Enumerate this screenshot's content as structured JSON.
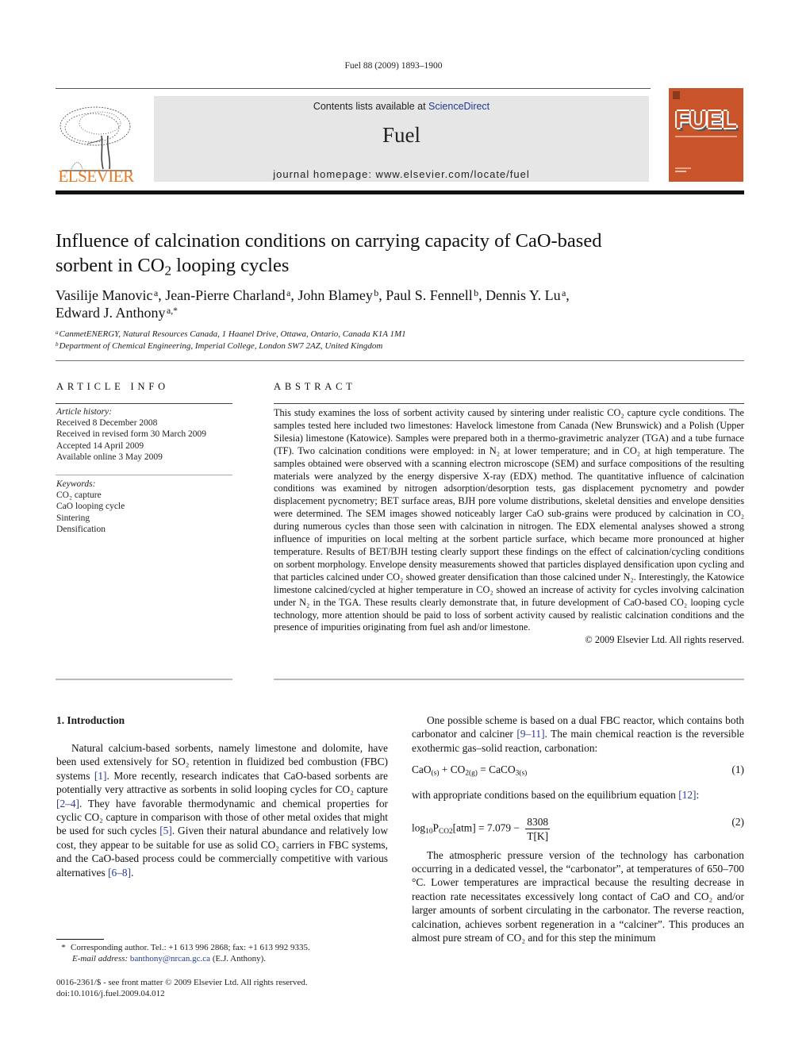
{
  "citation": "Fuel 88 (2009) 1893–1900",
  "masthead": {
    "contents_prefix": "Contents lists available at ",
    "contents_link": "ScienceDirect",
    "journal_title": "Fuel",
    "homepage": "journal homepage: www.elsevier.com/locate/fuel"
  },
  "publisher_logo_text": "ELSEVIER",
  "cover": {
    "title": "FUEL",
    "bg_color": "#c9542a"
  },
  "colors": {
    "link": "#2b3990",
    "elsevier_orange": "#e87722"
  },
  "article": {
    "title_line1": "Influence of calcination conditions on carrying capacity of CaO-based",
    "title_line2_pre": "sorbent in CO",
    "title_line2_sub": "2",
    "title_line2_post": " looping cycles",
    "authors": [
      {
        "name": "Vasilije Manovic",
        "aff": "a",
        "sep": ", "
      },
      {
        "name": "Jean-Pierre Charland",
        "aff": "a",
        "sep": ", "
      },
      {
        "name": "John Blamey",
        "aff": "b",
        "sep": ", "
      },
      {
        "name": "Paul S. Fennell",
        "aff": "b",
        "sep": ", "
      },
      {
        "name": "Dennis Y. Lu",
        "aff": "a",
        "sep": ","
      },
      {
        "name": "Edward J. Anthony",
        "aff": "a,*",
        "sep": ""
      }
    ],
    "affiliations": [
      {
        "label": "a",
        "text": "CanmetENERGY, Natural Resources Canada, 1 Haanel Drive, Ottawa, Ontario, Canada K1A 1M1"
      },
      {
        "label": "b",
        "text": "Department of Chemical Engineering, Imperial College, London SW7 2AZ, United Kingdom"
      }
    ]
  },
  "article_info": {
    "heading": "ARTICLE INFO",
    "history_label": "Article history:",
    "history": [
      "Received 8 December 2008",
      "Received in revised form 30 March 2009",
      "Accepted 14 April 2009",
      "Available online 3 May 2009"
    ],
    "keywords_label": "Keywords:",
    "keywords": [
      "CO₂ capture",
      "CaO looping cycle",
      "Sintering",
      "Densification"
    ]
  },
  "abstract": {
    "heading": "ABSTRACT",
    "text": "This study examines the loss of sorbent activity caused by sintering under realistic CO₂ capture cycle conditions. The samples tested here included two limestones: Havelock limestone from Canada (New Brunswick) and a Polish (Upper Silesia) limestone (Katowice). Samples were prepared both in a thermo-gravimetric analyzer (TGA) and a tube furnace (TF). Two calcination conditions were employed: in N₂ at lower temperature; and in CO₂ at high temperature. The samples obtained were observed with a scanning electron microscope (SEM) and surface compositions of the resulting materials were analyzed by the energy dispersive X-ray (EDX) method. The quantitative influence of calcination conditions was examined by nitrogen adsorption/desorption tests, gas displacement pycnometry and powder displacement pycnometry; BET surface areas, BJH pore volume distributions, skeletal densities and envelope densities were determined. The SEM images showed noticeably larger CaO sub-grains were produced by calcination in CO₂ during numerous cycles than those seen with calcination in nitrogen. The EDX elemental analyses showed a strong influence of impurities on local melting at the sorbent particle surface, which became more pronounced at higher temperature. Results of BET/BJH testing clearly support these findings on the effect of calcination/cycling conditions on sorbent morphology. Envelope density measurements showed that particles displayed densification upon cycling and that particles calcined under CO₂ showed greater densification than those calcined under N₂. Interestingly, the Katowice limestone calcined/cycled at higher temperature in CO₂ showed an increase of activity for cycles involving calcination under N₂ in the TGA. These results clearly demonstrate that, in future development of CaO-based CO₂ looping cycle technology, more attention should be paid to loss of sorbent activity caused by realistic calcination conditions and the presence of impurities originating from fuel ash and/or limestone.",
    "copyright": "© 2009 Elsevier Ltd. All rights reserved."
  },
  "introduction": {
    "heading": "1. Introduction",
    "left_paragraph": [
      {
        "t": "Natural calcium-based sorbents, namely limestone and dolomite, have been used extensively for SO₂ retention in fluidized bed combustion (FBC) systems "
      },
      {
        "ref": "[1]"
      },
      {
        "t": ". More recently, research indicates that CaO-based sorbents are potentially very attractive as sorbents in solid looping cycles for CO₂ capture "
      },
      {
        "ref": "[2–4]"
      },
      {
        "t": ". They have favorable thermodynamic and chemical properties for cyclic CO₂ capture in comparison with those of other metal oxides that might be used for such cycles "
      },
      {
        "ref": "[5]"
      },
      {
        "t": ". Given their natural abundance and relatively low cost, they appear to be suitable for use as solid CO₂ carriers in FBC systems, and the CaO-based process could be commercially competitive with various alternatives "
      },
      {
        "ref": "[6–8]"
      },
      {
        "t": "."
      }
    ],
    "right_p1": [
      {
        "t": "One possible scheme is based on a dual FBC reactor, which contains both carbonator and calciner "
      },
      {
        "ref": "[9–11]"
      },
      {
        "t": ". The main chemical reaction is the reversible exothermic gas–solid reaction, carbonation:"
      }
    ],
    "eq1": {
      "text": "CaO(s) + CO2(g) = CaCO3(s)",
      "number": "(1)"
    },
    "right_p2": [
      {
        "t": "with appropriate conditions based on the equilibrium equation "
      },
      {
        "ref": "[12]"
      },
      {
        "t": ":"
      }
    ],
    "eq2": {
      "lhs": "log10PCO2[atm] = 7.079 −",
      "numerator": "8308",
      "denominator": "T[K]",
      "number": "(2)"
    },
    "right_p3": "The atmospheric pressure version of the technology has carbonation occurring in a dedicated vessel, the “carbonator”, at temperatures of 650–700 °C. Lower temperatures are impractical because the resulting decrease in reaction rate necessitates excessively long contact of CaO and CO₂ and/or larger amounts of sorbent circulating in the carbonator. The reverse reaction, calcination, achieves sorbent regeneration in a “calciner”. This produces an almost pure stream of CO₂ and for this step the minimum"
  },
  "footnote": {
    "star": "*",
    "line1": "Corresponding author. Tel.: +1 613 996 2868; fax: +1 613 992 9335.",
    "email_label": "E-mail address:",
    "email": "banthony@nrcan.gc.ca",
    "email_suffix": " (E.J. Anthony)."
  },
  "front_matter": {
    "issn_line": "0016-2361/$ - see front matter © 2009 Elsevier Ltd. All rights reserved.",
    "doi": "doi:10.1016/j.fuel.2009.04.012"
  }
}
